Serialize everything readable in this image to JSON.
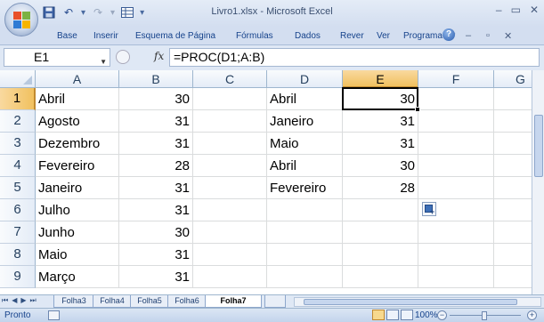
{
  "window": {
    "title": "Livro1.xlsx - Microsoft Excel",
    "controls": [
      "minimize",
      "maximize",
      "close"
    ]
  },
  "quick_access": [
    "save-icon",
    "undo-icon",
    "redo-icon",
    "table-icon",
    "customize-icon"
  ],
  "ribbon": {
    "tabs": [
      "Base",
      "Inserir",
      "Esquema de Página",
      "Fórmulas",
      "Dados",
      "Rever",
      "Ver",
      "Programador"
    ],
    "help_label": "?"
  },
  "formula_bar": {
    "name_box": "E1",
    "fx_label": "fx",
    "formula": "=PROC(D1;A:B)"
  },
  "grid": {
    "columns": [
      "A",
      "B",
      "C",
      "D",
      "E",
      "F",
      "G"
    ],
    "selected_column": "E",
    "rows": [
      "1",
      "2",
      "3",
      "4",
      "5",
      "6",
      "7",
      "8",
      "9"
    ],
    "selected_row": "1",
    "cells": [
      [
        "Abril",
        "30",
        "",
        "Abril",
        "30",
        "",
        ""
      ],
      [
        "Agosto",
        "31",
        "",
        "Janeiro",
        "31",
        "",
        ""
      ],
      [
        "Dezembro",
        "31",
        "",
        "Maio",
        "31",
        "",
        ""
      ],
      [
        "Fevereiro",
        "28",
        "",
        "Abril",
        "30",
        "",
        ""
      ],
      [
        "Janeiro",
        "31",
        "",
        "Fevereiro",
        "28",
        "",
        ""
      ],
      [
        "Julho",
        "31",
        "",
        "",
        "",
        "",
        ""
      ],
      [
        "Junho",
        "30",
        "",
        "",
        "",
        "",
        ""
      ],
      [
        "Maio",
        "31",
        "",
        "",
        "",
        "",
        ""
      ],
      [
        "Março",
        "31",
        "",
        "",
        "",
        "",
        ""
      ]
    ]
  },
  "sheet_tabs": {
    "tabs": [
      "Folha3",
      "Folha4",
      "Folha5",
      "Folha6",
      "Folha7"
    ],
    "active": "Folha7"
  },
  "status": {
    "text": "Pronto",
    "zoom": "100%"
  },
  "colors": {
    "ribbon_text": "#15428b",
    "selection_header": "#f1c15f",
    "grid_line": "#dadcdd"
  }
}
